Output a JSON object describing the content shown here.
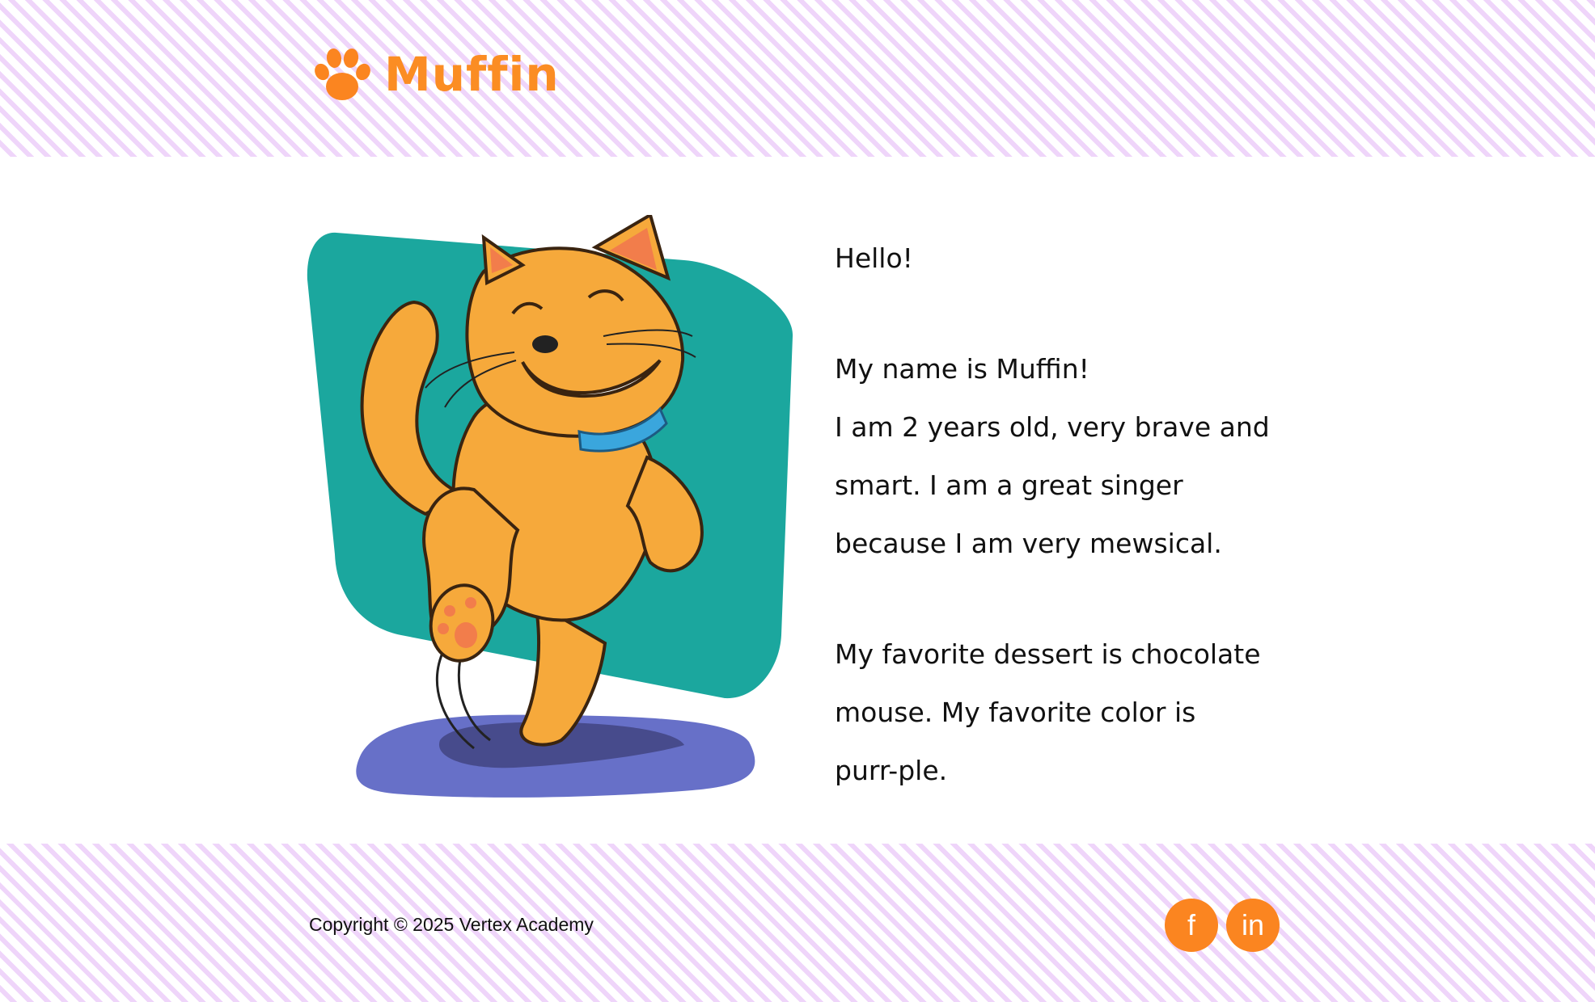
{
  "header": {
    "site_name": "Muffin"
  },
  "hero": {
    "image_alt": "Cartoon orange cat dancing"
  },
  "bio": {
    "greeting": "Hello!",
    "intro_lines": [
      "My name is Muffin!",
      "I am 2 years old, very brave and",
      "smart. I am a great singer",
      "because I am very mewsical."
    ],
    "favorites_lines": [
      "My favorite dessert is chocolate",
      "mouse. My favorite color is",
      "purr-ple."
    ]
  },
  "footer": {
    "copyright": "Copyright © 2025 Vertex Academy",
    "social": [
      {
        "name": "facebook-icon",
        "glyph": "f"
      },
      {
        "name": "linkedin-icon",
        "glyph": "in"
      }
    ]
  },
  "colors": {
    "brand_orange": "#fb8d23",
    "stripe_lilac": "#efd5fa",
    "hero_teal": "#1ba79e",
    "shadow_purple": "#6770c8"
  }
}
